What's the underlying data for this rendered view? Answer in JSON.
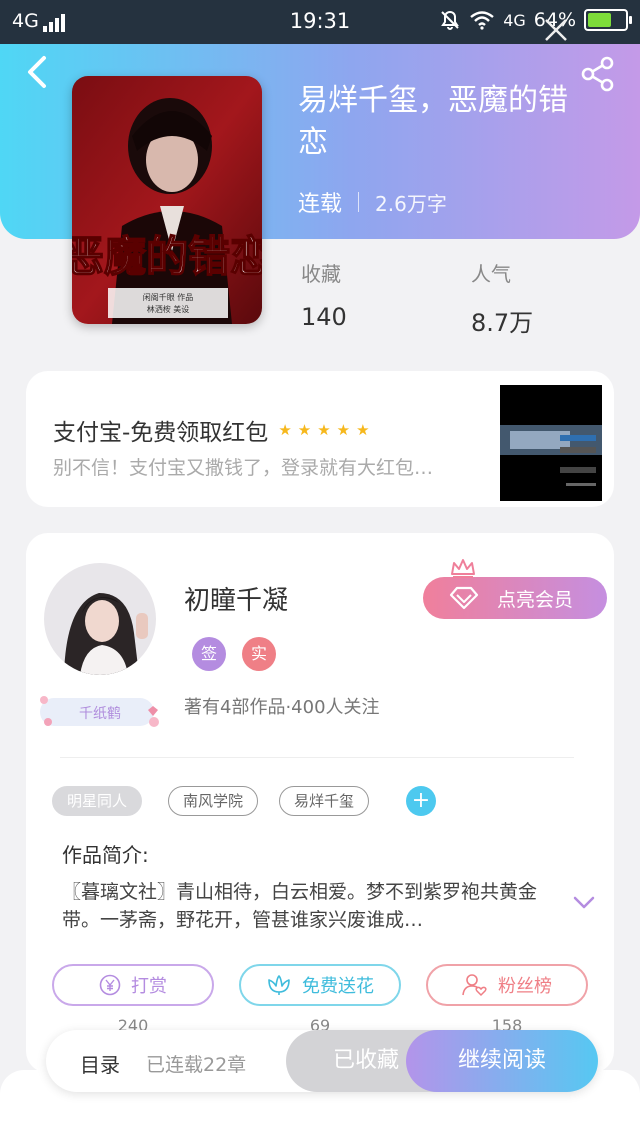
{
  "status_bar": {
    "network": "4G",
    "time": "19:31",
    "network_right": "4G",
    "battery": "64%",
    "battery_level": 0.64
  },
  "book": {
    "title": "易烊千玺，恶魔的错恋",
    "status": "连载",
    "word_count": "2.6万字",
    "cover_title": "恶魔的错恋",
    "cover_credit_1": "闲阁千眼 作品",
    "cover_credit_2": "林洒桉 美设",
    "stats": [
      {
        "label": "收藏",
        "value": "140"
      },
      {
        "label": "人气",
        "value": "8.7万"
      }
    ]
  },
  "ad": {
    "title": "支付宝-免费领取红包",
    "stars": "★★★★★",
    "description": "别不信！支付宝又撒钱了，登录就有大红包…"
  },
  "author": {
    "name": "初瞳千凝",
    "frame_label": "千纸鹤",
    "badges": [
      "签",
      "实"
    ],
    "stats": "著有4部作品·400人关注",
    "vip_button": "点亮会员"
  },
  "tags": [
    "明星同人",
    "南风学院",
    "易烊千玺"
  ],
  "tag_add": "+",
  "intro": {
    "label": "作品简介:",
    "text": "〖暮璃文社〗青山相待，白云相爱。梦不到紫罗袍共黄金带。一茅斋，野花开，管甚谁家兴废谁成…"
  },
  "actions": [
    {
      "label": "打赏",
      "count": "240",
      "color": "#b48ce0"
    },
    {
      "label": "免费送花",
      "count": "69",
      "color": "#4dc8e4"
    },
    {
      "label": "粉丝榜",
      "count": "158",
      "color": "#ef7f86"
    }
  ],
  "bottom": {
    "toc": "目录",
    "chapters": "已连载22章",
    "favorited": "已收藏",
    "continue": "继续阅读"
  },
  "colors": {
    "header_start": "#4fd7f5",
    "header_end": "#c49ae8",
    "star": "#f6b81d",
    "badge_sign": "#b48ce0",
    "badge_real": "#ef7f86"
  }
}
